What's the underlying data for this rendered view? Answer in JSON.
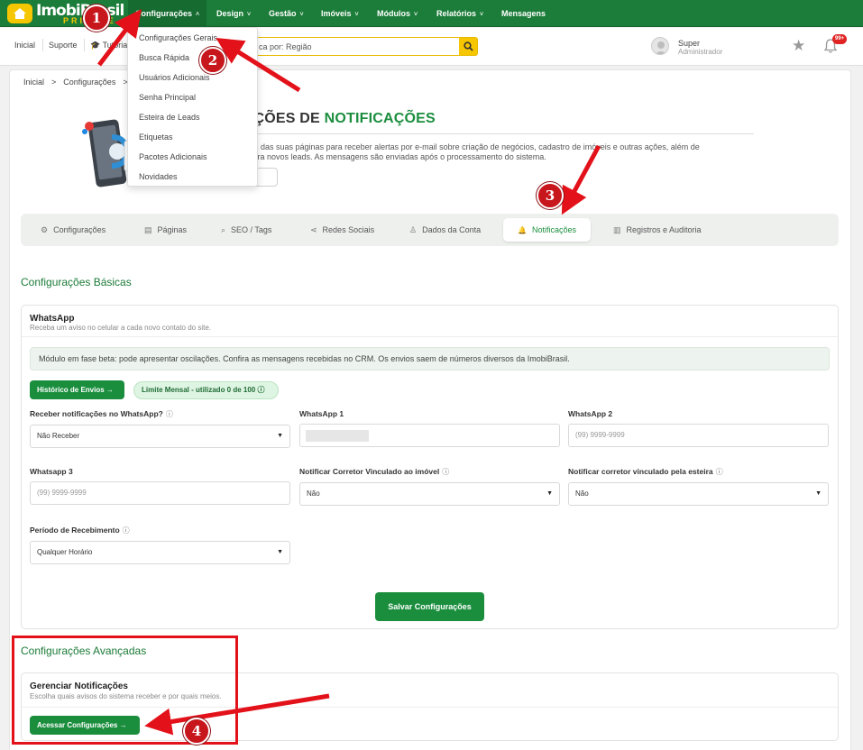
{
  "app": {
    "logo_text": "ImobiBrasil",
    "logo_sub": "PRIVATE"
  },
  "topnav": {
    "items": [
      {
        "label": "Configurações",
        "chevron": "˄"
      },
      {
        "label": "Design",
        "chevron": "˅"
      },
      {
        "label": "Gestão",
        "chevron": "˅"
      },
      {
        "label": "Imóveis",
        "chevron": "˅"
      },
      {
        "label": "Módulos",
        "chevron": "˅"
      },
      {
        "label": "Relatórios",
        "chevron": "˅"
      },
      {
        "label": "Mensagens",
        "chevron": ""
      }
    ]
  },
  "subbar": {
    "inicial": "Inicial",
    "suporte": "Suporte",
    "tutorial": "Tutoria",
    "search_text": "ca por: Região"
  },
  "user": {
    "name": "Super",
    "role": "Administrador",
    "notif_count": "99+"
  },
  "dropdown": {
    "items": [
      "Configurações Gerais",
      "Busca Rápida",
      "Usuários Adicionais",
      "Senha Principal",
      "Esteira de Leads",
      "Etiquetas",
      "Pacotes Adicionais",
      "Novidades"
    ]
  },
  "breadcrumb": {
    "items": [
      "Inicial",
      ">",
      "Configurações",
      ">"
    ]
  },
  "hero": {
    "title_prefix": "RAÇÕES DE ",
    "title_highlight": "NOTIFICAÇÕES",
    "desc_line1": "cações das suas páginas para receber alertas por e-mail sobre criação de negócios, cadastro de imóveis e outras ações, além de",
    "desc_line2": "ular para novos leads. As mensagens são enviadas após o processamento do sistema.",
    "button": "tivo"
  },
  "tabs": [
    {
      "label": "Configurações",
      "icon": "⚙"
    },
    {
      "label": "Páginas",
      "icon": "▤"
    },
    {
      "label": "SEO / Tags",
      "icon": "⌕"
    },
    {
      "label": "Redes Sociais",
      "icon": "⋖"
    },
    {
      "label": "Dados da Conta",
      "icon": "♙"
    },
    {
      "label": "Notificações",
      "icon": "🔔"
    },
    {
      "label": "Registros e Auditoria",
      "icon": "▥"
    }
  ],
  "basic": {
    "title": "Configurações Básicas",
    "whatsapp_title": "WhatsApp",
    "whatsapp_sub": "Receba um aviso no celular a cada novo contato do site.",
    "beta_msg": "Módulo em fase beta: pode apresentar oscilações. Confira as mensagens recebidas no CRM. Os envios saem de números diversos da ImobiBrasil.",
    "history_btn": "Histórico de Envios →",
    "limit_badge": "Limite Mensal - utilizado 0 de 100 ⓘ",
    "fields": {
      "receber_label": "Receber notificações no WhatsApp?",
      "receber_value": "Não Receber",
      "wa1_label": "WhatsApp 1",
      "wa2_label": "WhatsApp 2",
      "wa2_placeholder": "(99) 9999-9999",
      "wa3_label": "Whatsapp 3",
      "wa3_placeholder": "(99) 9999-9999",
      "corretor_label": "Notificar Corretor Vinculado ao imóvel",
      "corretor_value": "Não",
      "esteira_label": "Notificar corretor vinculado pela esteira",
      "esteira_value": "Não",
      "periodo_label": "Período de Recebimento",
      "periodo_value": "Qualquer Horário"
    },
    "save_btn": "Salvar Configurações"
  },
  "advanced": {
    "title": "Configurações Avançadas",
    "sub_title": "Gerenciar Notificações",
    "sub_desc": "Escolha quais avisos do sistema receber e por quais meios.",
    "access_btn": "Acessar Configurações →"
  },
  "annotations": [
    "1",
    "2",
    "3",
    "4"
  ],
  "colors": {
    "brand_green": "#1c7d3a",
    "accent_yellow": "#f6c600",
    "annotation_red": "#e3121a"
  }
}
